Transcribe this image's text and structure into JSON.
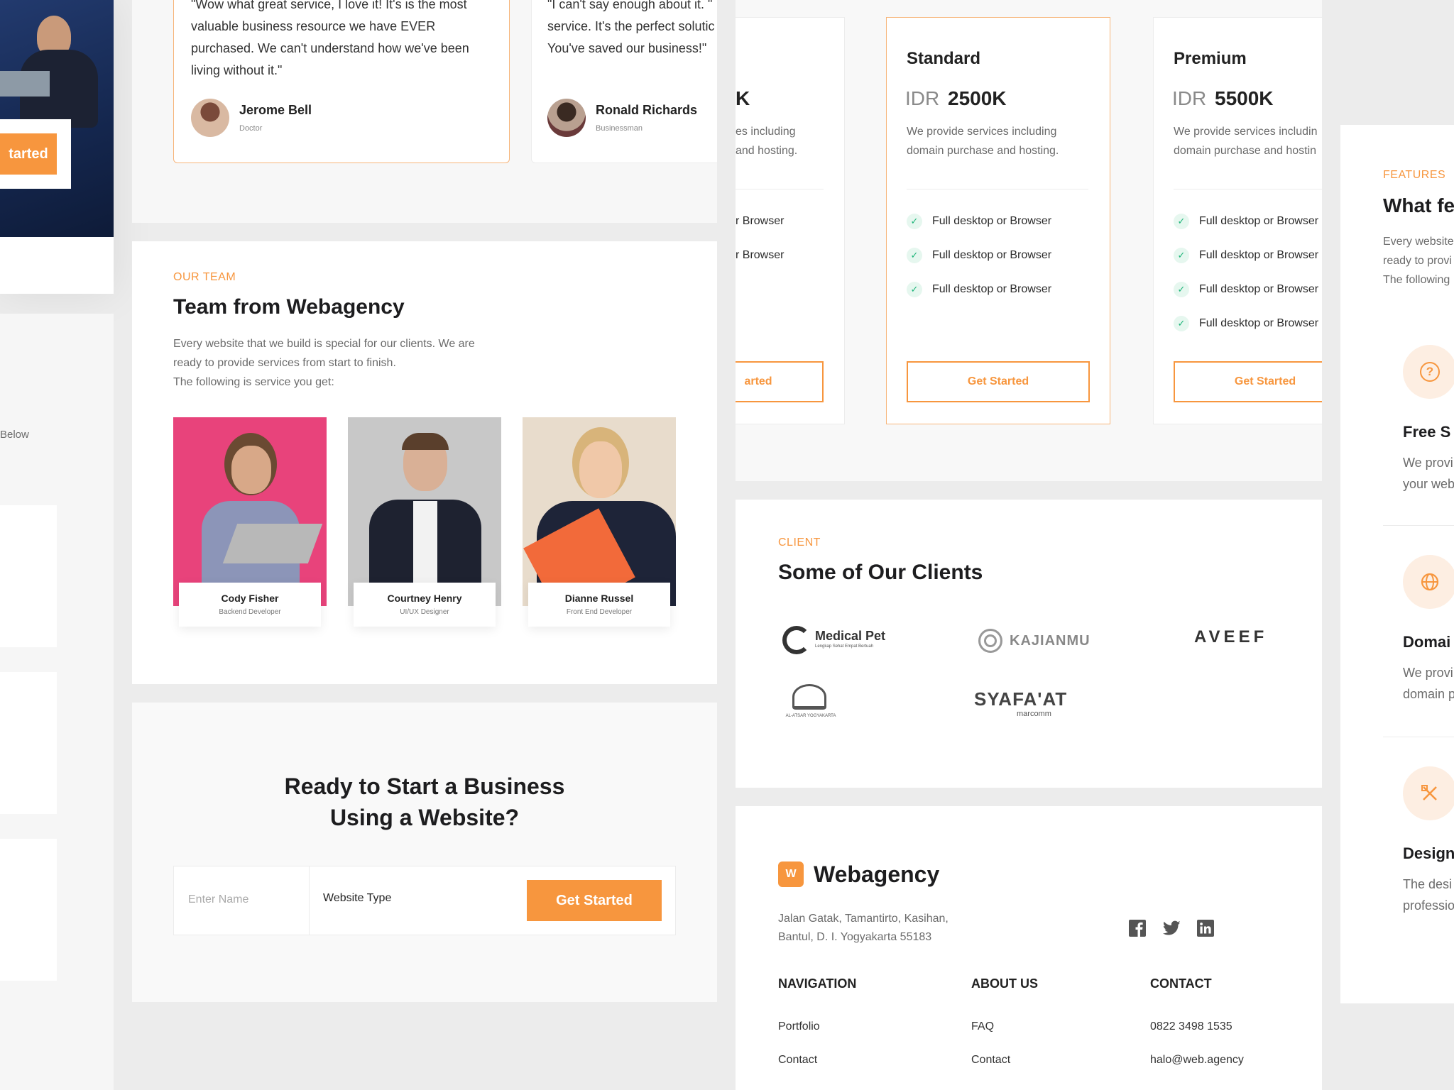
{
  "hero": {
    "cta_label": "tarted"
  },
  "left_strip": {
    "fragment": "Below"
  },
  "testimonials": [
    {
      "quote": "\"Wow what great service, I love it! It's is the most valuable business resource we have EVER purchased. We can't understand how we've been living without it.\"",
      "name": "Jerome Bell",
      "role": "Doctor"
    },
    {
      "quote": "\"I can't say enough about it. It's the perfect solution service. It's the perfect solutic You've saved our business!\"",
      "quote_lines": [
        "\"I can't say enough about it. \"",
        "service. It's the perfect solutic",
        "You've saved our business!\""
      ],
      "name": "Ronald Richards",
      "role": "Businessman"
    }
  ],
  "team": {
    "eyebrow": "OUR TEAM",
    "title": "Team from Webagency",
    "desc_lines": [
      "Every website that we build is special for our clients. We are",
      "ready to provide services from start to finish.",
      "The following is service you get:"
    ],
    "members": [
      {
        "name": "Cody Fisher",
        "role": "Backend Developer"
      },
      {
        "name": "Courtney Henry",
        "role": "UI/UX Designer"
      },
      {
        "name": "Dianne Russel",
        "role": "Front End Developer"
      }
    ]
  },
  "cta": {
    "title_line1": "Ready to Start a Business",
    "title_line2": "Using a Website?",
    "name_placeholder": "Enter Name",
    "type_value": "Website Type",
    "button": "Get Started"
  },
  "pricing": {
    "partial": {
      "price_fragment": "K",
      "desc_lines": [
        "es including",
        "and hosting."
      ],
      "features": [
        "r Browser",
        "r Browser"
      ],
      "button": "arted"
    },
    "plans": [
      {
        "name": "Standard",
        "currency": "IDR",
        "price": "2500K",
        "desc_lines": [
          "We provide services including",
          "domain purchase and hosting."
        ],
        "features": [
          "Full desktop or Browser",
          "Full desktop or Browser",
          "Full desktop or Browser"
        ],
        "button": "Get Started"
      },
      {
        "name": "Premium",
        "currency": "IDR",
        "price": "5500K",
        "desc_lines": [
          "We provide services includin",
          "domain purchase and hostin"
        ],
        "features": [
          "Full desktop or Browser",
          "Full desktop or Browser",
          "Full desktop or Browser",
          "Full desktop or Browser"
        ],
        "button": "Get Started"
      }
    ]
  },
  "clients": {
    "eyebrow": "CLIENT",
    "title": "Some of Our Clients",
    "logos": [
      "Medical Pet",
      "KAJIANMU",
      "AVEEF",
      "AL-ATSAR YOGYAKARTA",
      "SYAFA'AT"
    ],
    "logo_sub": {
      "medical": "Lengkap Sehat Empat Bertuah",
      "syafaat": "marcomm"
    }
  },
  "footer": {
    "brand": "Webagency",
    "brand_mark": "W",
    "address_lines": [
      "Jalan Gatak, Tamantirto, Kasihan,",
      "Bantul, D. I. Yogyakarta 55183"
    ],
    "columns": [
      {
        "title": "NAVIGATION",
        "links": [
          "Portfolio",
          "Contact"
        ]
      },
      {
        "title": "ABOUT US",
        "links": [
          "FAQ",
          "Contact"
        ]
      },
      {
        "title": "CONTACT",
        "links": [
          "0822 3498 1535",
          "halo@web.agency"
        ]
      }
    ]
  },
  "features": {
    "eyebrow": "FEATURES",
    "title": "What fe",
    "desc_lines": [
      "Every website",
      "ready to provi",
      "The following"
    ],
    "items": [
      {
        "title": "Free S",
        "lines": [
          "We provi",
          "your web"
        ]
      },
      {
        "title": "Domai",
        "lines": [
          "We provi",
          "domain p"
        ]
      },
      {
        "title": "Design",
        "lines": [
          "The desi",
          "professio"
        ]
      }
    ]
  },
  "colors": {
    "accent": "#f7963e",
    "check_green": "#1fb57a",
    "dark_blue": "#1b2c55"
  }
}
